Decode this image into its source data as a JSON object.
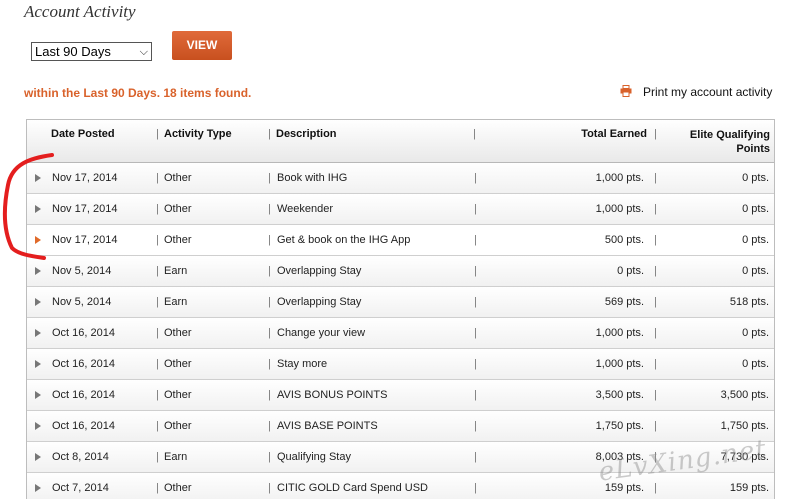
{
  "page": {
    "title": "Account Activity"
  },
  "filter": {
    "period": "Last 90 Days",
    "view_label": "VIEW"
  },
  "summary": {
    "found_text": "within the Last 90 Days. 18 items found.",
    "print_label": "Print my account activity"
  },
  "table": {
    "headers": {
      "date": "Date Posted",
      "type": "Activity Type",
      "desc": "Description",
      "earned": "Total Earned",
      "elite1": "Elite Qualifying",
      "elite2": "Points"
    },
    "rows": [
      {
        "date": "Nov 17, 2014",
        "type": "Other",
        "desc": "Book with IHG",
        "earned": "1,000 pts.",
        "elite": "0 pts."
      },
      {
        "date": "Nov 17, 2014",
        "type": "Other",
        "desc": "Weekender",
        "earned": "1,000 pts.",
        "elite": "0 pts."
      },
      {
        "date": "Nov 17, 2014",
        "type": "Other",
        "desc": "Get & book on the IHG App",
        "earned": "500 pts.",
        "elite": "0 pts."
      },
      {
        "date": "Nov 5, 2014",
        "type": "Earn",
        "desc": "Overlapping Stay",
        "earned": "0 pts.",
        "elite": "0 pts."
      },
      {
        "date": "Nov 5, 2014",
        "type": "Earn",
        "desc": "Overlapping Stay",
        "earned": "569 pts.",
        "elite": "518 pts."
      },
      {
        "date": "Oct 16, 2014",
        "type": "Other",
        "desc": "Change your view",
        "earned": "1,000 pts.",
        "elite": "0 pts."
      },
      {
        "date": "Oct 16, 2014",
        "type": "Other",
        "desc": "Stay more",
        "earned": "1,000 pts.",
        "elite": "0 pts."
      },
      {
        "date": "Oct 16, 2014",
        "type": "Other",
        "desc": "AVIS BONUS POINTS",
        "earned": "3,500 pts.",
        "elite": "3,500 pts."
      },
      {
        "date": "Oct 16, 2014",
        "type": "Other",
        "desc": "AVIS BASE POINTS",
        "earned": "1,750 pts.",
        "elite": "1,750 pts."
      },
      {
        "date": "Oct 8, 2014",
        "type": "Earn",
        "desc": "Qualifying Stay",
        "earned": "8,003 pts.",
        "elite": "7,730 pts."
      },
      {
        "date": "Oct 7, 2014",
        "type": "Other",
        "desc": "CITIC GOLD Card Spend USD",
        "earned": "159 pts.",
        "elite": "159 pts."
      }
    ]
  },
  "watermark": "eLvXing.net",
  "colors": {
    "accent": "#d9622b",
    "button": "#d65a28",
    "annotation": "#e41e1e"
  }
}
